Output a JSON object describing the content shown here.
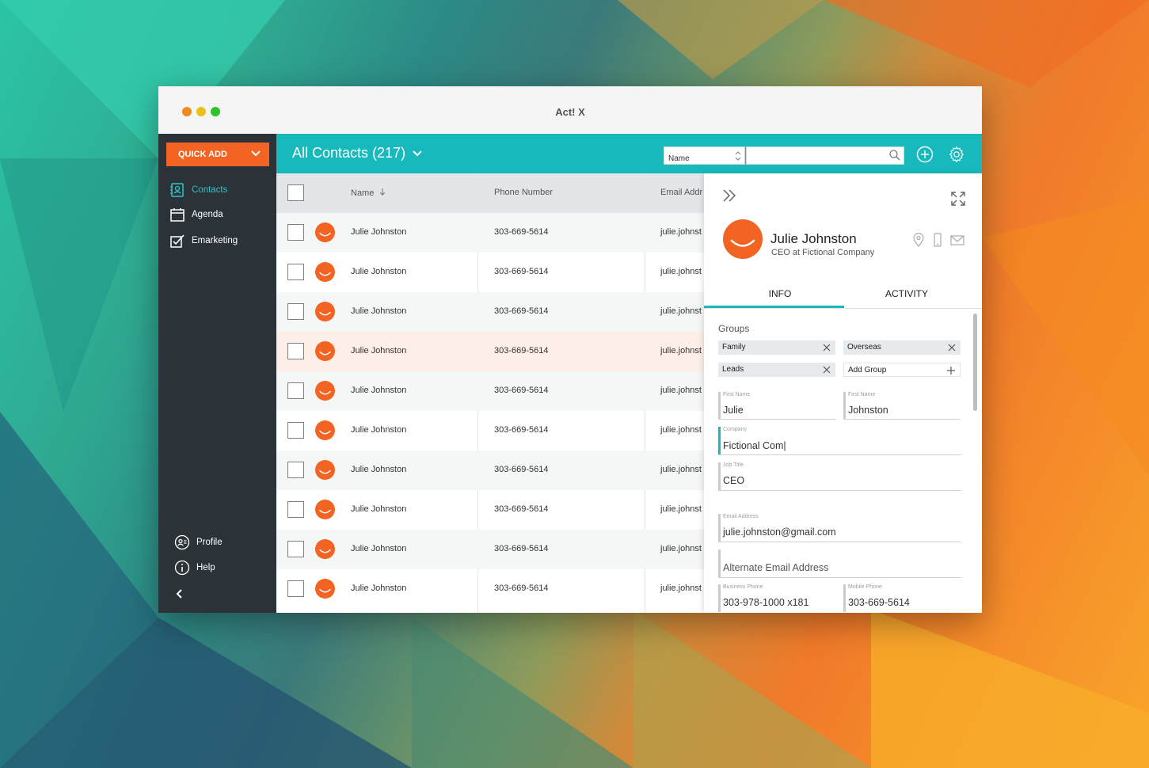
{
  "window": {
    "title": "Act! X"
  },
  "sidebar": {
    "quick_add": "QUICK ADD",
    "items": [
      {
        "label": "Contacts",
        "icon": "contacts-icon",
        "active": true
      },
      {
        "label": "Agenda",
        "icon": "calendar-icon",
        "active": false
      },
      {
        "label": "Emarketing",
        "icon": "emarketing-icon",
        "active": false
      }
    ],
    "bottom": [
      {
        "label": "Profile",
        "icon": "profile-icon"
      },
      {
        "label": "Help",
        "icon": "info-icon"
      }
    ]
  },
  "header": {
    "list_title": "All Contacts (217)",
    "search_field": "Name",
    "search_value": ""
  },
  "table": {
    "columns": [
      "Name",
      "Phone Number",
      "Email Addr"
    ],
    "rows": [
      {
        "name": "Julie Johnston",
        "phone": "303-669-5614",
        "email": "julie.johnst"
      },
      {
        "name": "Julie Johnston",
        "phone": "303-669-5614",
        "email": "julie.johnst"
      },
      {
        "name": "Julie Johnston",
        "phone": "303-669-5614",
        "email": "julie.johnst"
      },
      {
        "name": "Julie Johnston",
        "phone": "303-669-5614",
        "email": "julie.johnst"
      },
      {
        "name": "Julie Johnston",
        "phone": "303-669-5614",
        "email": "julie.johnst"
      },
      {
        "name": "Julie Johnston",
        "phone": "303-669-5614",
        "email": "julie.johnst"
      },
      {
        "name": "Julie Johnston",
        "phone": "303-669-5614",
        "email": "julie.johnst"
      },
      {
        "name": "Julie Johnston",
        "phone": "303-669-5614",
        "email": "julie.johnst"
      },
      {
        "name": "Julie Johnston",
        "phone": "303-669-5614",
        "email": "julie.johnst"
      },
      {
        "name": "Julie Johnston",
        "phone": "303-669-5614",
        "email": "julie.johnst"
      }
    ]
  },
  "detail": {
    "name": "Julie Johnston",
    "subtitle": "CEO at Fictional Company",
    "tabs": [
      "INFO",
      "ACTIVITY"
    ],
    "groups_title": "Groups",
    "groups": [
      "Family",
      "Overseas",
      "Leads"
    ],
    "add_group": "Add Group",
    "fields": {
      "first_name": {
        "label": "First Name",
        "value": "Julie"
      },
      "last_name": {
        "label": "First Name",
        "value": "Johnston"
      },
      "company": {
        "label": "Company",
        "value": "Fictional Com|"
      },
      "job_title": {
        "label": "Job Title",
        "value": "CEO"
      },
      "email": {
        "label": "Email Address",
        "value": "julie.johnston@gmail.com"
      },
      "alt_email": {
        "placeholder": "Alternate Email Address"
      },
      "business_phone": {
        "label": "Business Phone",
        "value": "303-978-1000 x181"
      },
      "mobile_phone": {
        "label": "Mobile Phone",
        "value": "303-669-5614"
      }
    }
  },
  "colors": {
    "accent": "#17b9bd",
    "brand_orange": "#f36321",
    "sidebar": "#2b3238",
    "selected_row": "#fdefe8"
  }
}
